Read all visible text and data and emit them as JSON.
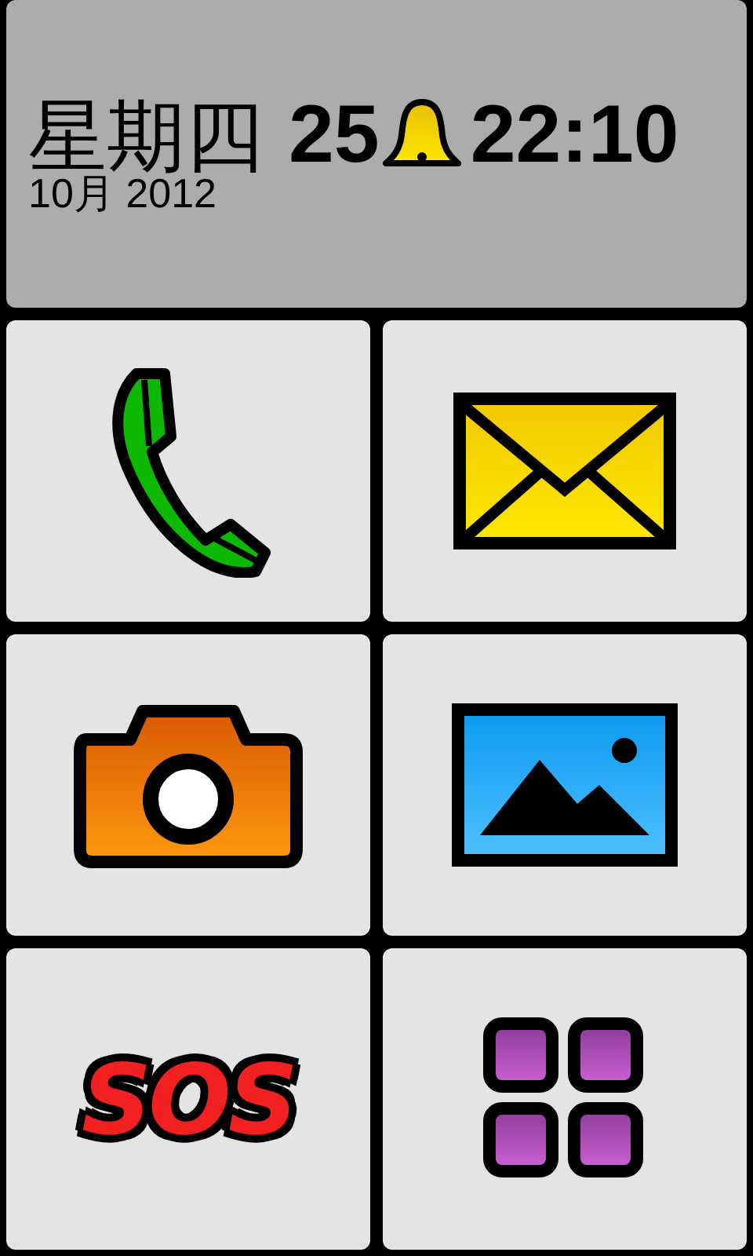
{
  "header": {
    "weekday": "星期四",
    "day": "25",
    "alarm": true,
    "time": "22:10",
    "month_year": "10月 2012"
  },
  "tiles": [
    {
      "kind": "phone"
    },
    {
      "kind": "message"
    },
    {
      "kind": "camera"
    },
    {
      "kind": "gallery"
    },
    {
      "kind": "sos",
      "label": "SOS"
    },
    {
      "kind": "apps"
    }
  ]
}
